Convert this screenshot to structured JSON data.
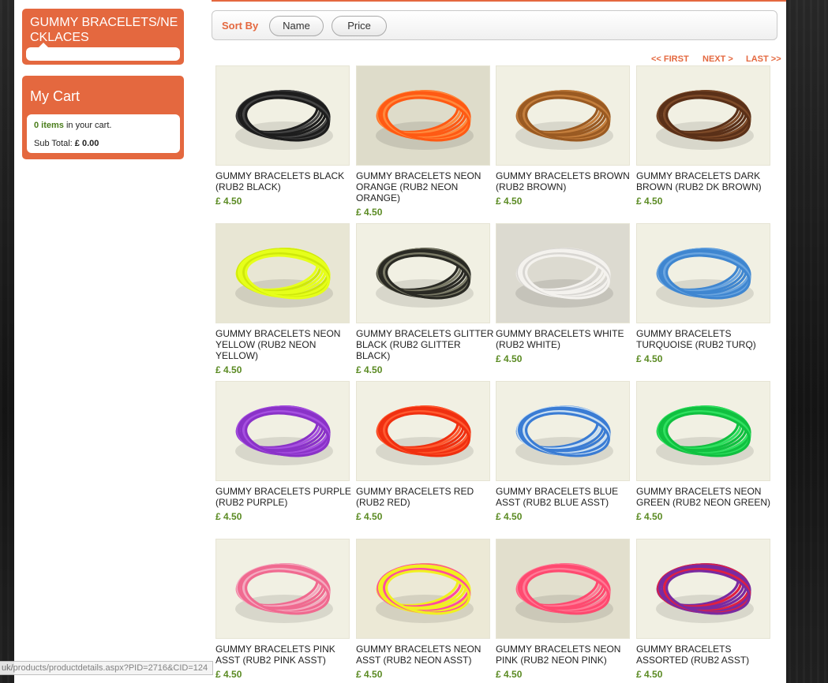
{
  "sidebar": {
    "category_title": "GUMMY BRACELETS/NECKLACES",
    "cart": {
      "title": "My Cart",
      "count_text": "0 items",
      "count_suffix": " in your cart.",
      "subtotal_label": "Sub Total: ",
      "subtotal_value": "£ 0.00"
    }
  },
  "sort": {
    "label": "Sort By",
    "options": [
      "Name",
      "Price"
    ]
  },
  "pager": {
    "first": "<< FIRST",
    "next": "NEXT >",
    "last": "LAST >>"
  },
  "products": [
    {
      "name": "GUMMY BRACELETS BLACK (RUB2 BLACK)",
      "price": "£ 4.50",
      "color": "#1d1d1d",
      "accent": "#444444",
      "bg": "#f1f0e3"
    },
    {
      "name": "GUMMY BRACELETS NEON ORANGE (RUB2 NEON ORANGE)",
      "price": "£ 4.50",
      "color": "#ff5a14",
      "accent": "#ff8a3d",
      "bg": "#dedcca"
    },
    {
      "name": "GUMMY BRACELETS BROWN (RUB2 BROWN)",
      "price": "£ 4.50",
      "color": "#9a5a22",
      "accent": "#c47e3c",
      "bg": "#f1f0e3"
    },
    {
      "name": "GUMMY BRACELETS DARK BROWN (RUB2 DK BROWN)",
      "price": "£ 4.50",
      "color": "#5a3018",
      "accent": "#7d4a28",
      "bg": "#f1f0e3"
    },
    {
      "name": "GUMMY BRACELETS NEON YELLOW (RUB2 NEON YELLOW)",
      "price": "£ 4.50",
      "color": "#e6ff1a",
      "accent": "#cfe80a",
      "bg": "#e8e6d4"
    },
    {
      "name": "GUMMY BRACELETS GLITTER BLACK (RUB2 GLITTER BLACK)",
      "price": "£ 4.50",
      "color": "#2a2a24",
      "accent": "#7a7a66",
      "bg": "#f1f0e3"
    },
    {
      "name": "GUMMY BRACELETS WHITE (RUB2 WHITE)",
      "price": "£ 4.50",
      "color": "#f4f2ee",
      "accent": "#d8d6d2",
      "bg": "#dcdad0"
    },
    {
      "name": "GUMMY BRACELETS TURQUOISE (RUB2 TURQ)",
      "price": "£ 4.50",
      "color": "#3f86d0",
      "accent": "#6aa5e0",
      "bg": "#f1f0e3"
    },
    {
      "name": "GUMMY BRACELETS PURPLE (RUB2 PURPLE)",
      "price": "£ 4.50",
      "color": "#8a32c8",
      "accent": "#a650e0",
      "bg": "#f1f0e3"
    },
    {
      "name": "GUMMY BRACELETS RED (RUB2 RED)",
      "price": "£ 4.50",
      "color": "#f03010",
      "accent": "#ff5a30",
      "bg": "#f1f0e3"
    },
    {
      "name": "GUMMY BRACELETS BLUE ASST (RUB2 BLUE ASST)",
      "price": "£ 4.50",
      "color": "#3a7cd4",
      "accent": "#c8def2",
      "bg": "#f1f0e3"
    },
    {
      "name": "GUMMY BRACELETS NEON GREEN (RUB2 NEON GREEN)",
      "price": "£ 4.50",
      "color": "#10c040",
      "accent": "#30e060",
      "bg": "#f1f0e3"
    },
    {
      "name": "GUMMY BRACELETS PINK ASST (RUB2 PINK ASST)",
      "price": "£ 4.50",
      "color": "#f06a90",
      "accent": "#f4aac0",
      "bg": "#f1f0e3"
    },
    {
      "name": "GUMMY BRACELETS NEON ASST (RUB2 NEON ASST)",
      "price": "£ 4.50",
      "color": "#f0f020",
      "accent": "#ff4aa0",
      "bg": "#ece9d6"
    },
    {
      "name": "GUMMY BRACELETS NEON PINK (RUB2 NEON PINK)",
      "price": "£ 4.50",
      "color": "#ff4a70",
      "accent": "#ff7a96",
      "bg": "#e2dfcd"
    },
    {
      "name": "GUMMY BRACELETS ASSORTED (RUB2 ASST)",
      "price": "£ 4.50",
      "color": "#7a2aa0",
      "accent": "#e02040",
      "bg": "#f1f0e3"
    }
  ],
  "status_url": "uk/products/productdetails.aspx?PID=2716&CID=124"
}
